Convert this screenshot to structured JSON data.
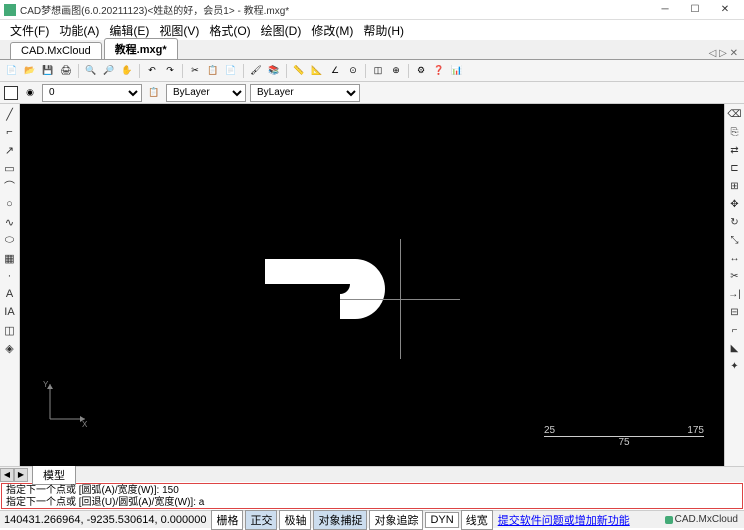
{
  "window": {
    "title": "CAD梦想画图(6.0.20211123)<姓赵的好，会员1> - 教程.mxg*",
    "min": "─",
    "max": "☐",
    "close": "✕"
  },
  "menu": {
    "file": "文件(F)",
    "func": "功能(A)",
    "edit": "编辑(E)",
    "view": "视图(V)",
    "format": "格式(O)",
    "draw": "绘图(D)",
    "modify": "修改(M)",
    "help": "帮助(H)"
  },
  "tabs": {
    "cloud": "CAD.MxCloud",
    "doc": "教程.mxg*",
    "rightctl": "◁ ▷ ✕"
  },
  "props": {
    "layer": "0",
    "linetype": "ByLayer",
    "lineweight": "ByLayer"
  },
  "scale": {
    "a": "25",
    "b": "75",
    "c": "175"
  },
  "modeltab": "模型",
  "cmd": {
    "l1": "指定下一个点或 [圆弧(A)/宽度(W)]: 150",
    "l2": "指定下一个点或 [回退(U)/圆弧(A)/宽度(W)]: a"
  },
  "status": {
    "coords": "140431.266964, -9235.530614, 0.000000",
    "grid": "栅格",
    "ortho": "正交",
    "polar": "极轴",
    "osnap": "对象捕捉",
    "otrack": "对象追踪",
    "dyn": "DYN",
    "lwt": "线宽",
    "feedback": "提交软件问题或增加新功能",
    "brand": "CAD.MxCloud"
  }
}
